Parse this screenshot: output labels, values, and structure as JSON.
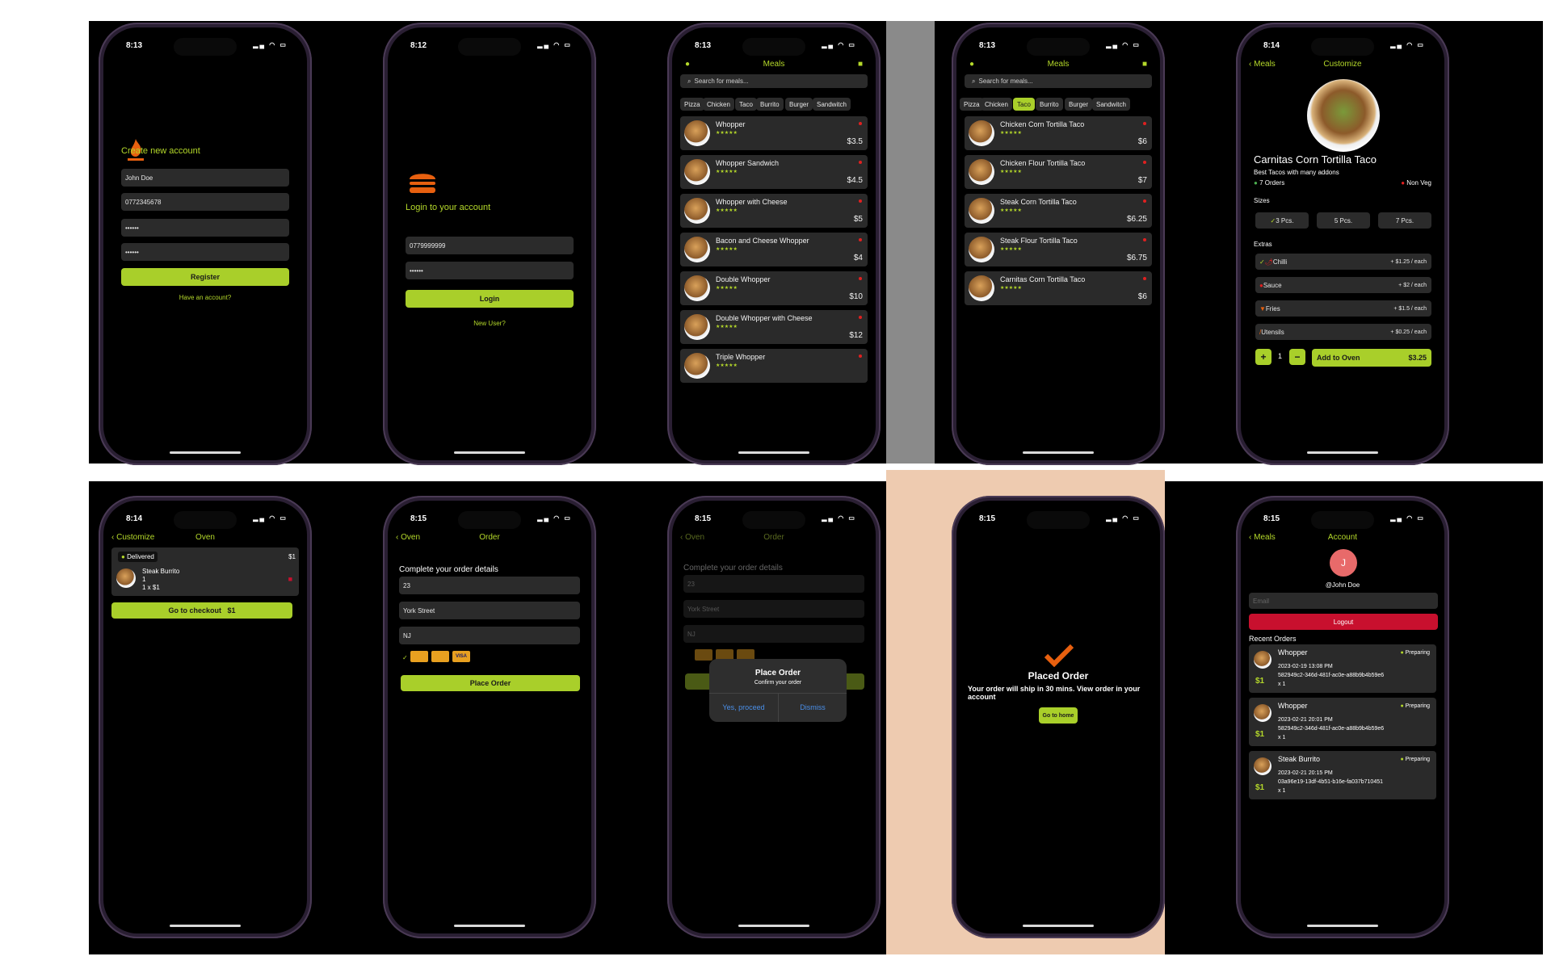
{
  "colors": {
    "accent": "#a9cf2a",
    "brand_orange": "#e8600f",
    "danger": "#c8102e",
    "bg": "#000000"
  },
  "status_times": [
    "8:13",
    "8:12",
    "8:13",
    "8:13",
    "8:14",
    "8:14",
    "8:15",
    "8:15",
    "8:15",
    "8:15"
  ],
  "register": {
    "title": "Create new account",
    "name_value": "John Doe",
    "phone_value": "0772345678",
    "password_mask": "••••••",
    "confirm_mask": "••••••",
    "register_label": "Register",
    "have_account_label": "Have an account?"
  },
  "login": {
    "title": "Login to your account",
    "phone_value": "0779999999",
    "password_mask": "••••••",
    "login_label": "Login",
    "new_user_label": "New User?"
  },
  "meals": {
    "title": "Meals",
    "search_placeholder": "Search for meals...",
    "categories": [
      "Pizza",
      "Chicken",
      "Taco",
      "Burrito",
      "Burger",
      "Sandwitch"
    ],
    "items": [
      {
        "name": "Whopper",
        "price": "$3.5"
      },
      {
        "name": "Whopper Sandwich",
        "price": "$4.5"
      },
      {
        "name": "Whopper with Cheese",
        "price": "$5"
      },
      {
        "name": "Bacon and Cheese Whopper",
        "price": "$4"
      },
      {
        "name": "Double Whopper",
        "price": "$10"
      },
      {
        "name": "Double Whopper with Cheese",
        "price": "$12"
      },
      {
        "name": "Triple Whopper",
        "price": ""
      }
    ],
    "stars": "★★★★★"
  },
  "tacos": {
    "title": "Meals",
    "search_placeholder": "Search for meals...",
    "categories": [
      "Pizza",
      "Chicken",
      "Taco",
      "Burrito",
      "Burger",
      "Sandwitch"
    ],
    "active_category": "Taco",
    "items": [
      {
        "name": "Chicken Corn Tortilla Taco",
        "price": "$6"
      },
      {
        "name": "Chicken Flour Tortilla Taco",
        "price": "$7"
      },
      {
        "name": "Steak Corn Tortilla Taco",
        "price": "$6.25"
      },
      {
        "name": "Steak Flour Tortilla Taco",
        "price": "$6.75"
      },
      {
        "name": "Carnitas Corn Tortilla Taco",
        "price": "$6"
      }
    ]
  },
  "customize": {
    "back_label": "Meals",
    "title": "Customize",
    "meal_name": "Carnitas Corn Tortilla Taco",
    "subtitle": "Best Tacos with many addons",
    "orders": "7 Orders",
    "veg": "Non Veg",
    "sizes_label": "Sizes",
    "sizes": [
      "3 Pcs.",
      "5 Pcs.",
      "7 Pcs."
    ],
    "extras_label": "Extras",
    "extras": [
      {
        "name": "Chilli",
        "price": "+ $1.25 / each",
        "checked": true
      },
      {
        "name": "Sauce",
        "price": "+ $2 / each",
        "checked": false
      },
      {
        "name": "Fries",
        "price": "+ $1.5 / each",
        "checked": false
      },
      {
        "name": "Utensils",
        "price": "+ $0.25 / each",
        "checked": false
      }
    ],
    "qty": "1",
    "add_label": "Add to Oven",
    "add_price": "$3.25",
    "plus": "+",
    "minus": "−"
  },
  "oven": {
    "back_label": "Customize",
    "title": "Oven",
    "status": "Delivered",
    "total": "$1",
    "item_name": "Steak Burrito",
    "item_qty": "1",
    "item_line": "1 x $1",
    "checkout_label": "Go to checkout",
    "checkout_price": "$1"
  },
  "order": {
    "back_label": "Oven",
    "title": "Order",
    "heading": "Complete your order details",
    "house": "23",
    "street": "York Street",
    "state": "NJ",
    "cards": [
      "VISA"
    ],
    "place_label": "Place Order"
  },
  "order_alert": {
    "title": "Place Order",
    "message": "Confirm your order",
    "proceed": "Yes, proceed",
    "dismiss": "Dismiss"
  },
  "placed": {
    "title": "Placed Order",
    "message": "Your order will ship in 30 mins. View order in your account",
    "home_label": "Go to home"
  },
  "account": {
    "back_label": "Meals",
    "title": "Account",
    "avatar_letter": "J",
    "username": "@John Doe",
    "email_placeholder": "Email",
    "logout_label": "Logout",
    "recent_label": "Recent Orders",
    "orders": [
      {
        "name": "Whopper",
        "status": "Preparing",
        "date": "2023-02-19 13:08 PM",
        "id": "582949c2-346d-481f-ac0e-a88b9b4b59e6",
        "qty": "x 1",
        "price": "$1"
      },
      {
        "name": "Whopper",
        "status": "Preparing",
        "date": "2023-02-21 20:01 PM",
        "id": "582949c2-346d-481f-ac0e-a88b9b4b59e6",
        "qty": "x 1",
        "price": "$1"
      },
      {
        "name": "Steak Burrito",
        "status": "Preparing",
        "date": "2023-02-21 20:15 PM",
        "id": "03a96e19-13df-4b51-b16e-fa037b710451",
        "qty": "x 1",
        "price": "$1"
      }
    ]
  }
}
